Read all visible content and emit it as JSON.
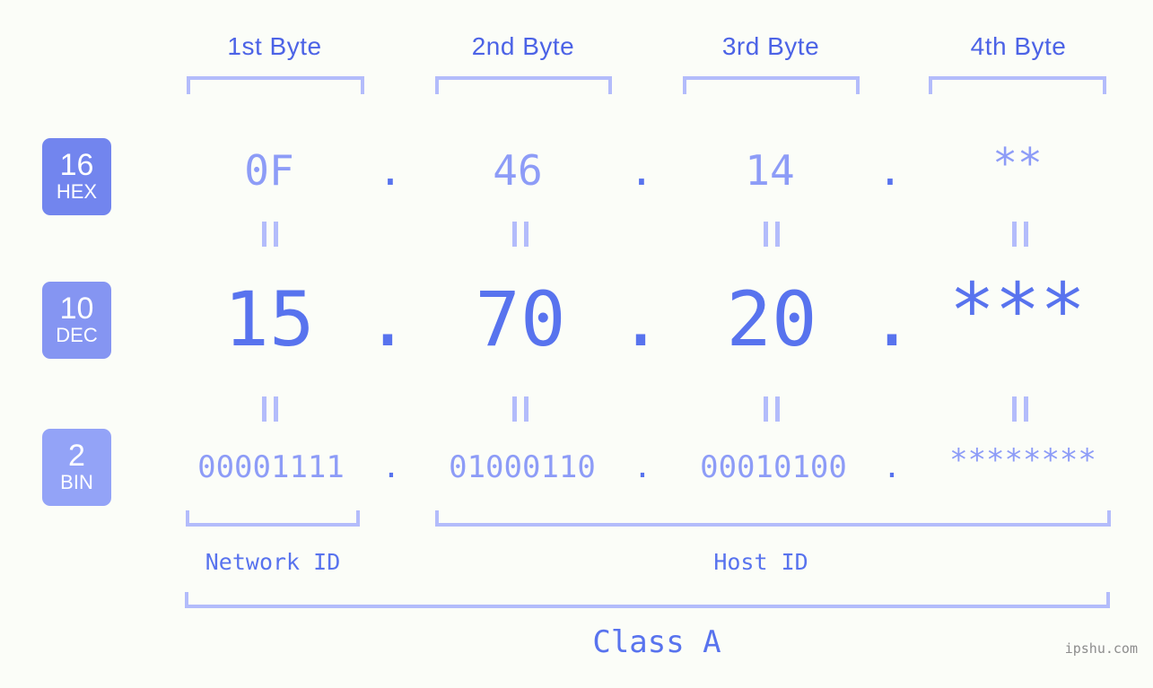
{
  "background_color": "#fbfdf8",
  "colors": {
    "accent_strong": "#5873ee",
    "accent_light": "#8d9cf7",
    "bracket": "#b3bcfb",
    "badge_hex": "#7285ee",
    "badge_dec": "#8595f2",
    "badge_bin": "#93a3f7",
    "watermark": "#8d8d8d"
  },
  "headers": [
    {
      "label": "1st Byte"
    },
    {
      "label": "2nd Byte"
    },
    {
      "label": "3rd Byte"
    },
    {
      "label": "4th Byte"
    }
  ],
  "bases": [
    {
      "number": "16",
      "name": "HEX"
    },
    {
      "number": "10",
      "name": "DEC"
    },
    {
      "number": "2",
      "name": "BIN"
    }
  ],
  "rows": {
    "hex": {
      "bytes": [
        "0F",
        "46",
        "14",
        "**"
      ],
      "separator": "."
    },
    "dec": {
      "bytes": [
        "15",
        "70",
        "20",
        "***"
      ],
      "separator": "."
    },
    "bin": {
      "bytes": [
        "00001111",
        "01000110",
        "00010100",
        "********"
      ],
      "separator": "."
    }
  },
  "equivalence_symbol": "||",
  "segments": [
    {
      "label": "Network ID"
    },
    {
      "label": "Host ID"
    }
  ],
  "class": {
    "label": "Class A"
  },
  "watermark": {
    "text": "ipshu.com"
  }
}
